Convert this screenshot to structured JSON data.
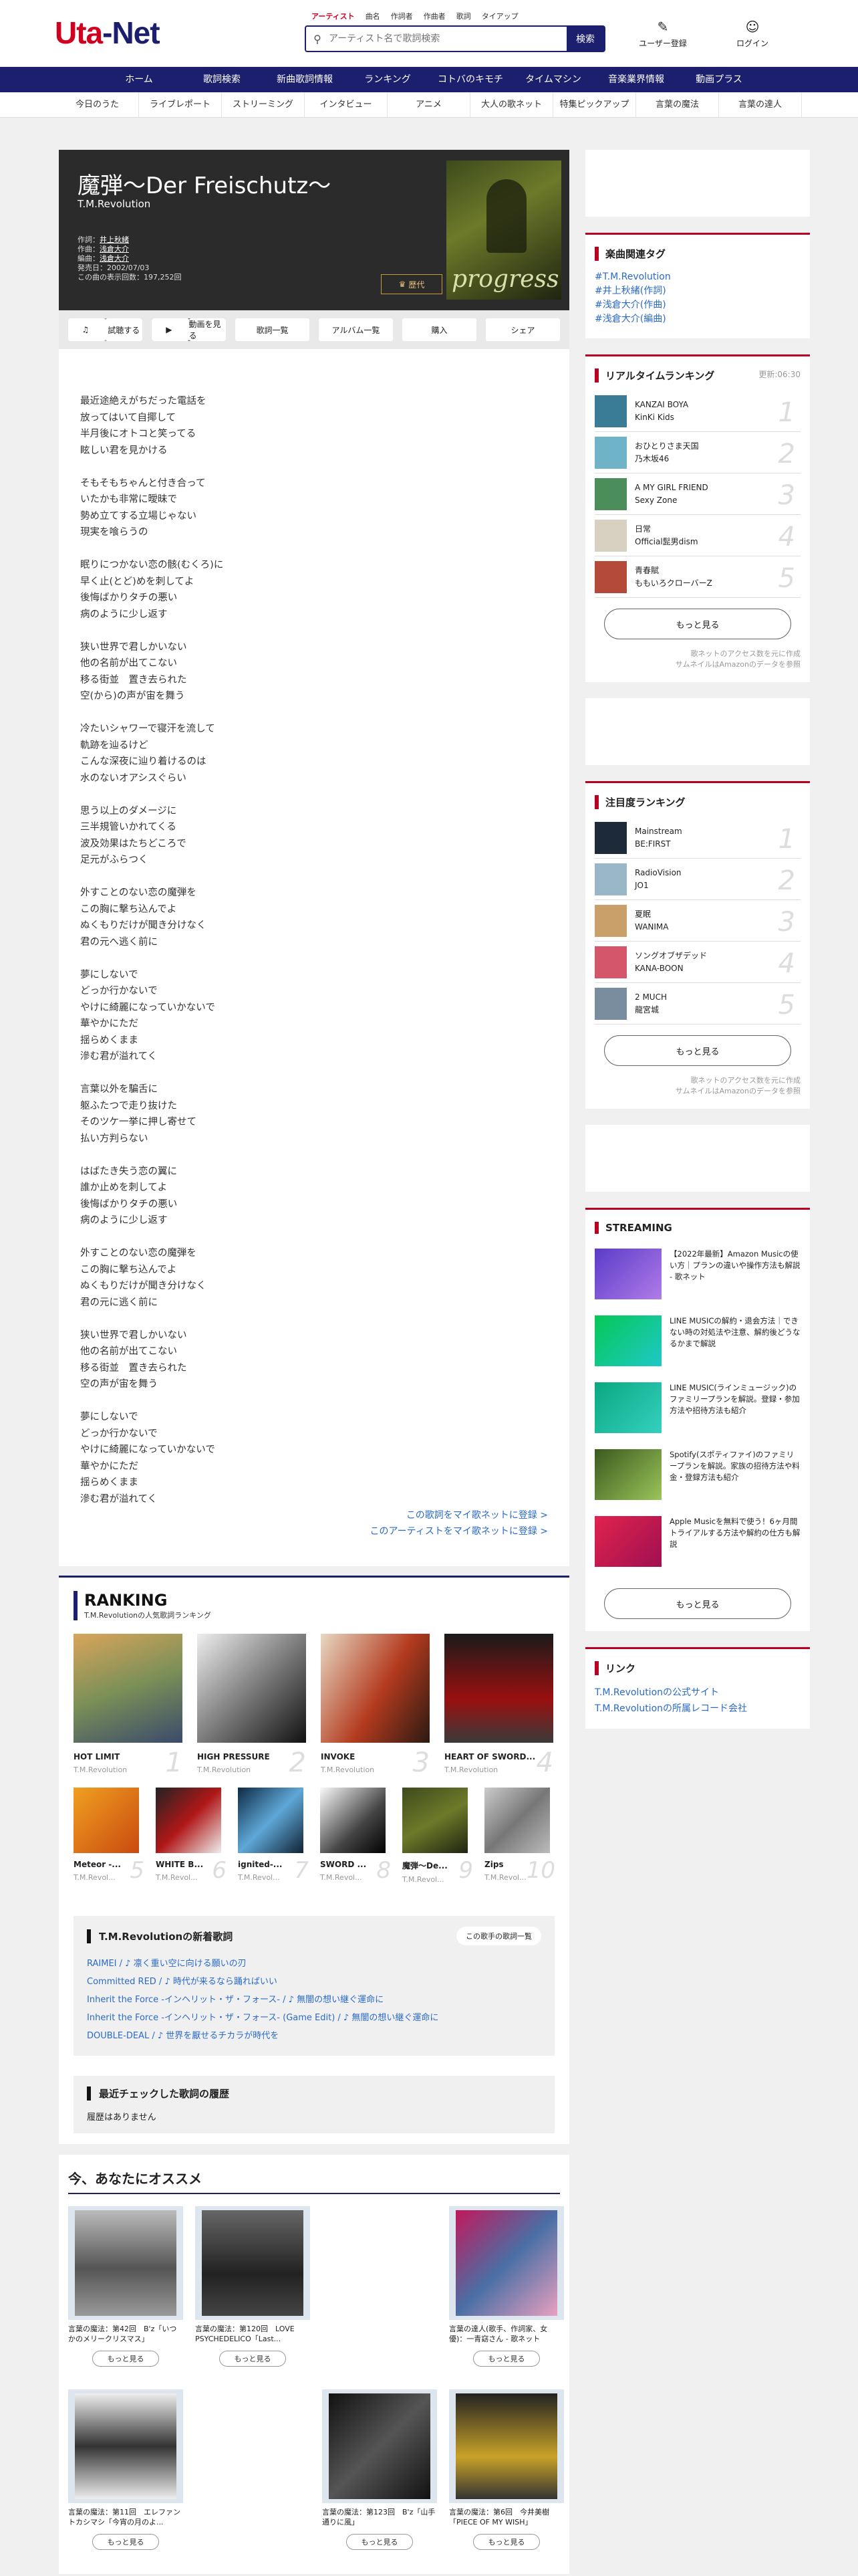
{
  "header": {
    "logo_uta": "Uta",
    "logo_net": "-Net",
    "search_tabs": [
      "アーティスト",
      "曲名",
      "作詞者",
      "作曲者",
      "歌詞",
      "タイアップ"
    ],
    "search_placeholder": "アーティスト名で歌詞検索",
    "search_button": "検索",
    "register": "ユーザー登録",
    "login": "ログイン"
  },
  "nav_main": [
    "ホーム",
    "歌詞検索",
    "新曲歌詞情報",
    "ランキング",
    "コトバのキモチ",
    "タイムマシン",
    "音楽業界情報",
    "動画プラス"
  ],
  "nav_sub": [
    "今日のうた",
    "ライブレポート",
    "ストリーミング",
    "インタビュー",
    "アニメ",
    "大人の歌ネット",
    "特集ピックアップ",
    "言葉の魔法",
    "言葉の達人"
  ],
  "song": {
    "title": "魔弾〜Der Freischutz〜",
    "artist": "T.M.Revolution",
    "lyricist_label": "作詞：",
    "lyricist": "井上秋緒",
    "composer_label": "作曲：",
    "composer": "浅倉大介",
    "arranger_label": "編曲：",
    "arranger": "浅倉大介",
    "release": "発売日：2002/07/03",
    "views": "この曲の表示回数：197,252回",
    "jacket_text": "progress",
    "crown_label": "歴代"
  },
  "buttons": [
    "試聴する",
    "動画を見る",
    "歌詞一覧",
    "アルバム一覧",
    "購入",
    "シェア"
  ],
  "lyrics": [
    "最近途絶えがちだった電話を\n放ってはいて自揶して\n半月後にオトコと笑ってる\n眩しい君を見かける",
    "そもそもちゃんと付き合って\nいたかも非常に曖昧で\n勢め立てする立場じゃない\n現実を喰らうの",
    "眠りにつかない恋の骸(むくろ)に\n早く止(とど)めを刺してよ\n後悔ばかりタチの悪い\n病のように少し返す",
    "狭い世界で君しかいない\n他の名前が出てこない\n移る街並　置き去られた\n空(から)の声が宙を舞う",
    "冷たいシャワーで寝汗を流して\n軌跡を辿るけど\nこんな深夜に辿り着けるのは\n水のないオアシスぐらい",
    "思う以上のダメージに\n三半規管いかれてくる\n波及効果はたちどころで\n足元がふらつく",
    "外すことのない恋の魔弾を\nこの胸に撃ち込んでよ\nぬくもりだけが聞き分けなく\n君の元へ逃く前に",
    "夢にしないで\nどっか行かないで\nやけに綺麗になっていかないで\n華やかにただ\n揺らめくまま\n滲む君が溢れてく",
    "言葉以外を騙舌に\n躯ふたつで走り抜けた\nそのツケ一挙に押し寄せて\n払い方判らない",
    "はばたき失う恋の翼に\n誰か止めを刺してよ\n後悔ばかりタチの悪い\n病のように少し返す",
    "外すことのない恋の魔弾を\nこの胸に撃ち込んでよ\nぬくもりだけが聞き分けなく\n君の元に逃く前に",
    "狭い世界で君しかいない\n他の名前が出てこない\n移る街並　置き去られた\n空の声が宙を舞う",
    "夢にしないで\nどっか行かないで\nやけに綺麗になっていかないで\n華やかにただ\n揺らめくまま\n滲む君が溢れてく"
  ],
  "register_links": [
    "この歌詞をマイ歌ネットに登録 >",
    "このアーティストをマイ歌ネットに登録 >"
  ],
  "ranking": {
    "title": "RANKING",
    "subtitle": "T.M.Revolutionの人気歌詞ランキング",
    "top": [
      {
        "name": "HOT LIMIT",
        "artist": "T.M.Revolution",
        "no": "1"
      },
      {
        "name": "HIGH PRESSURE",
        "artist": "T.M.Revolution",
        "no": "2"
      },
      {
        "name": "INVOKE",
        "artist": "T.M.Revolution",
        "no": "3"
      },
      {
        "name": "HEART OF SWORD...",
        "artist": "T.M.Revolution",
        "no": "4"
      }
    ],
    "rest": [
      {
        "name": "Meteor -...",
        "artist": "T.M.Revol...",
        "no": "5"
      },
      {
        "name": "WHITE B...",
        "artist": "T.M.Revol...",
        "no": "6"
      },
      {
        "name": "ignited-...",
        "artist": "T.M.Revol...",
        "no": "7"
      },
      {
        "name": "SWORD ...",
        "artist": "T.M.Revol...",
        "no": "8"
      },
      {
        "name": "魔弾〜De...",
        "artist": "T.M.Revol...",
        "no": "9"
      },
      {
        "name": "Zips",
        "artist": "T.M.Revol...",
        "no": "10"
      }
    ]
  },
  "new_songs": {
    "title": "T.M.Revolutionの新着歌詞",
    "more": "この歌手の歌詞一覧",
    "items": [
      "RAIMEI / ♪ 凛く重い空に向ける願いの刃",
      "Committed RED / ♪ 時代が来るなら踊ればいい",
      "Inherit the Force -インヘリット・ザ・フォース- / ♪ 無闇の想い継ぐ運命に",
      "Inherit the Force -インヘリット・ザ・フォース- (Game Edit) / ♪ 無闇の想い継ぐ運命に",
      "DOUBLE-DEAL / ♪ 世界を厭せるチカラが時代を"
    ]
  },
  "history": {
    "title": "最近チェックした歌詞の履歴",
    "empty": "履歴はありません"
  },
  "recommend": {
    "title": "今、あなたにオススメ",
    "more": "もっと見る",
    "items": [
      {
        "text": "言葉の魔法：第42回　B'z「いつかのメリークリスマス」"
      },
      {
        "text": "言葉の魔法：第120回　LOVE PSYCHEDELICO「Last..."
      },
      {
        "text": ""
      },
      {
        "text": "言葉の達人(歌手、作詞家、女優)：一青窈さん - 歌ネット"
      },
      {
        "text": "言葉の魔法：第11回　エレファントカシマシ「今宵の月のよ..."
      },
      {
        "text": ""
      },
      {
        "text": "言葉の魔法：第123回　B'z「山手通りに風」"
      },
      {
        "text": "言葉の魔法：第6回　今井美樹「PIECE OF MY WISH」"
      }
    ]
  },
  "side": {
    "tags_title": "楽曲関連タグ",
    "tags": [
      "#T.M.Revolution",
      "#井上秋緒(作詞)",
      "#浅倉大介(作曲)",
      "#浅倉大介(編曲)"
    ],
    "realtime_title": "リアルタイムランキング",
    "realtime_updated": "更新:06:30",
    "realtime": [
      {
        "song": "KANZAI BOYA",
        "artist": "KinKi Kids",
        "no": "1"
      },
      {
        "song": "おひとりさま天国",
        "artist": "乃木坂46",
        "no": "2"
      },
      {
        "song": "A MY GIRL FRIEND",
        "artist": "Sexy Zone",
        "no": "3"
      },
      {
        "song": "日常",
        "artist": "Official髭男dism",
        "no": "4"
      },
      {
        "song": "青春賦",
        "artist": "ももいろクローバーZ",
        "no": "5"
      }
    ],
    "more": "もっと見る",
    "note1": "歌ネットのアクセス数を元に作成",
    "note2": "サムネイルはAmazonのデータを参照",
    "attention_title": "注目度ランキング",
    "attention": [
      {
        "song": "Mainstream",
        "artist": "BE:FIRST",
        "no": "1"
      },
      {
        "song": "RadioVision",
        "artist": "JO1",
        "no": "2"
      },
      {
        "song": "夏眠",
        "artist": "WANIMA",
        "no": "3"
      },
      {
        "song": "ソングオブザデッド",
        "artist": "KANA-BOON",
        "no": "4"
      },
      {
        "song": "2 MUCH",
        "artist": "龍宮城",
        "no": "5"
      }
    ],
    "streaming_title": "STREAMING",
    "streaming": [
      "【2022年最新】Amazon Musicの使い方｜プランの違いや操作方法も解説 - 歌ネット",
      "LINE MUSICの解約・退会方法｜できない時の対処法や注意、解約後どうなるかまで解説",
      "LINE MUSIC(ラインミュージック)のファミリープランを解説。登録・参加方法や招待方法も紹介",
      "Spotify(スポティファイ)のファミリープランを解説。家族の招待方法や料金・登録方法も紹介",
      "Apple Musicを無料で使う！6ヶ月間トライアルする方法や解約の仕方も解説"
    ],
    "links_title": "リンク",
    "links": [
      "T.M.Revolutionの公式サイト",
      "T.M.Revolutionの所属レコード会社"
    ]
  },
  "colors": {
    "navy": "#1b1f6e",
    "red": "#d2001f",
    "link": "#2a6ac9"
  }
}
